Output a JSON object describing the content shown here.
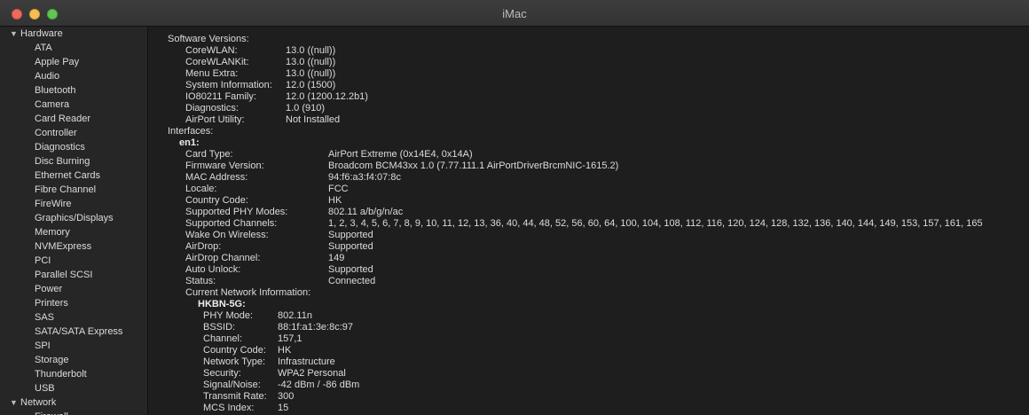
{
  "window": {
    "title": "iMac"
  },
  "sidebar": {
    "hardware": {
      "label": "Hardware",
      "items": [
        "ATA",
        "Apple Pay",
        "Audio",
        "Bluetooth",
        "Camera",
        "Card Reader",
        "Controller",
        "Diagnostics",
        "Disc Burning",
        "Ethernet Cards",
        "Fibre Channel",
        "FireWire",
        "Graphics/Displays",
        "Memory",
        "NVMExpress",
        "PCI",
        "Parallel SCSI",
        "Power",
        "Printers",
        "SAS",
        "SATA/SATA Express",
        "SPI",
        "Storage",
        "Thunderbolt",
        "USB"
      ]
    },
    "network": {
      "label": "Network",
      "items": [
        "Firewall"
      ]
    }
  },
  "content": {
    "software_heading": "Software Versions:",
    "software": [
      {
        "label": "CoreWLAN:",
        "value": "13.0 ((null))"
      },
      {
        "label": "CoreWLANKit:",
        "value": "13.0 ((null))"
      },
      {
        "label": "Menu Extra:",
        "value": "13.0 ((null))"
      },
      {
        "label": "System Information:",
        "value": "12.0 (1500)"
      },
      {
        "label": "IO80211 Family:",
        "value": "12.0 (1200.12.2b1)"
      },
      {
        "label": "Diagnostics:",
        "value": "1.0 (910)"
      },
      {
        "label": "AirPort Utility:",
        "value": "Not Installed"
      }
    ],
    "interfaces_heading": "Interfaces:",
    "interface_name": "en1:",
    "interface": [
      {
        "label": "Card Type:",
        "value": "AirPort Extreme  (0x14E4, 0x14A)"
      },
      {
        "label": "Firmware Version:",
        "value": "Broadcom BCM43xx 1.0 (7.77.111.1 AirPortDriverBrcmNIC-1615.2)"
      },
      {
        "label": "MAC Address:",
        "value": "94:f6:a3:f4:07:8c"
      },
      {
        "label": "Locale:",
        "value": "FCC"
      },
      {
        "label": "Country Code:",
        "value": "HK"
      },
      {
        "label": "Supported PHY Modes:",
        "value": "802.11 a/b/g/n/ac"
      },
      {
        "label": "Supported Channels:",
        "value": "1, 2, 3, 4, 5, 6, 7, 8, 9, 10, 11, 12, 13, 36, 40, 44, 48, 52, 56, 60, 64, 100, 104, 108, 112, 116, 120, 124, 128, 132, 136, 140, 144, 149, 153, 157, 161, 165"
      },
      {
        "label": "Wake On Wireless:",
        "value": "Supported"
      },
      {
        "label": "AirDrop:",
        "value": "Supported"
      },
      {
        "label": "AirDrop Channel:",
        "value": "149"
      },
      {
        "label": "Auto Unlock:",
        "value": "Supported"
      },
      {
        "label": "Status:",
        "value": "Connected"
      }
    ],
    "current_network_heading": "Current Network Information:",
    "network_name": "HKBN-5G:",
    "network": [
      {
        "label": "PHY Mode:",
        "value": "802.11n"
      },
      {
        "label": "BSSID:",
        "value": "88:1f:a1:3e:8c:97"
      },
      {
        "label": "Channel:",
        "value": "157,1"
      },
      {
        "label": "Country Code:",
        "value": "HK"
      },
      {
        "label": "Network Type:",
        "value": "Infrastructure"
      },
      {
        "label": "Security:",
        "value": "WPA2 Personal"
      },
      {
        "label": "Signal/Noise:",
        "value": "-42 dBm / -86 dBm"
      },
      {
        "label": "Transmit Rate:",
        "value": "300"
      },
      {
        "label": "MCS Index:",
        "value": "15"
      }
    ]
  }
}
